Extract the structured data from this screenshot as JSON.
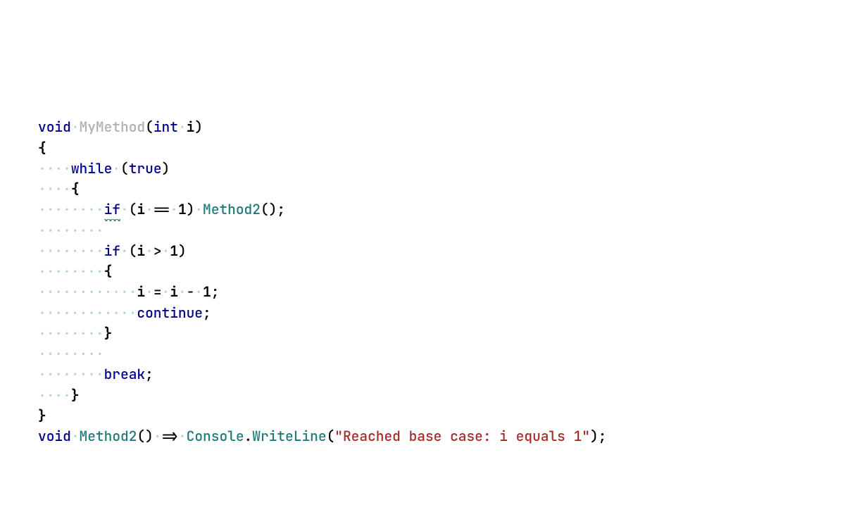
{
  "tokens": {
    "void": "void",
    "mymethod": "MyMethod",
    "int": "int",
    "i": "i",
    "while": "while",
    "true": "true",
    "if": "if",
    "eq": "==",
    "one": "1",
    "method2": "Method2",
    "gt": ">",
    "assign": "=",
    "minus": "-",
    "continue": "continue",
    "break": "break",
    "arrow": "=>",
    "console": "Console",
    "writeline": "WriteLine",
    "string": "\"Reached base case: i equals 1\""
  },
  "ws4": "····",
  "ws8": "········",
  "ws12": "············",
  "dotsep": "·"
}
